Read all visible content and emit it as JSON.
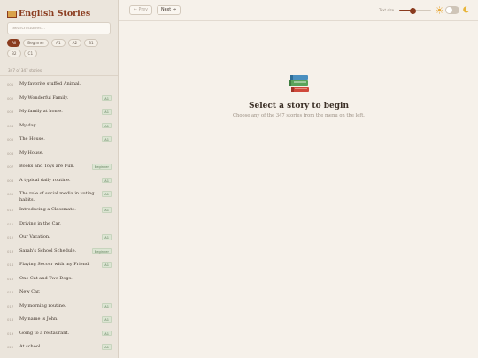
{
  "app": {
    "title": "English Stories",
    "icon": "book-open-icon"
  },
  "search": {
    "placeholder": "Search stories..."
  },
  "levels": [
    "All",
    "Beginner",
    "A1",
    "A2",
    "B1",
    "B2",
    "C1"
  ],
  "active_level": "All",
  "count_text": "347 of 347 stories",
  "stories": [
    {
      "num": "001",
      "title": "My favorite stuffed Animal.",
      "badge": ""
    },
    {
      "num": "002",
      "title": "My Wonderful Family.",
      "badge": "A1"
    },
    {
      "num": "003",
      "title": "My family at home.",
      "badge": "A1"
    },
    {
      "num": "004",
      "title": "My day.",
      "badge": "A1"
    },
    {
      "num": "005",
      "title": "The House.",
      "badge": "A1"
    },
    {
      "num": "006",
      "title": "My House.",
      "badge": ""
    },
    {
      "num": "007",
      "title": "Books and Toys are Fun.",
      "badge": "Beginner"
    },
    {
      "num": "008",
      "title": "A typical daily routine.",
      "badge": "A1"
    },
    {
      "num": "009",
      "title": "The role of social media in voting habits.",
      "badge": "A1"
    },
    {
      "num": "010",
      "title": "Introducing a Classmate.",
      "badge": "A1"
    },
    {
      "num": "011",
      "title": "Driving in the Car.",
      "badge": ""
    },
    {
      "num": "012",
      "title": "Our Vacation.",
      "badge": "A1"
    },
    {
      "num": "013",
      "title": "Sarah's School Schedule.",
      "badge": "Beginner"
    },
    {
      "num": "014",
      "title": "Playing Soccer with my Friend.",
      "badge": "A1"
    },
    {
      "num": "015",
      "title": "One Cat and Two Dogs.",
      "badge": ""
    },
    {
      "num": "016",
      "title": "New Car.",
      "badge": ""
    },
    {
      "num": "017",
      "title": "My morning routine.",
      "badge": "A1"
    },
    {
      "num": "018",
      "title": "My name is John.",
      "badge": "A1"
    },
    {
      "num": "019",
      "title": "Going to a restaurant.",
      "badge": "A1"
    },
    {
      "num": "020",
      "title": "At school.",
      "badge": "A1"
    }
  ],
  "toolbar": {
    "prev_label": "← Prev",
    "next_label": "Next →",
    "text_size_label": "Text size",
    "text_size_fraction": 0.42,
    "dark_mode": false,
    "sun_icon": "sun-icon",
    "moon_icon": "moon-icon"
  },
  "empty_state": {
    "icon": "books-icon",
    "title": "Select a story to begin",
    "subtitle": "Choose any of the 347 stories from the menu on the left."
  },
  "colors": {
    "accent": "#8a3b1e",
    "badge_bg": "#dce5d3",
    "badge_text": "#5d7d58",
    "sidebar_bg": "#ebe5dc",
    "page_bg": "#f6f1ea"
  }
}
